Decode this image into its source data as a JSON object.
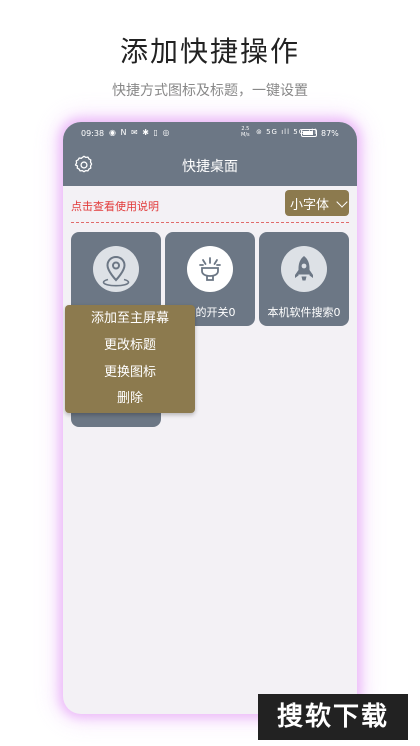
{
  "header": {
    "title": "添加快捷操作",
    "subtitle": "快捷方式图标及标题，一键设置"
  },
  "statusbar": {
    "time": "09:38",
    "left_icons": "◉ N ✉ ✱ ▯ ◎",
    "speed_value": "2.5",
    "speed_unit": "M/s",
    "signal": "⊚ 5G ıll 5G ıll",
    "battery_text": "87%",
    "battery_level": 0.87
  },
  "app": {
    "title": "快捷桌面",
    "settings_icon": "gear-icon",
    "help_link": "点击查看使用说明",
    "font_select": "小字体"
  },
  "cards": [
    {
      "label": "",
      "icon": "location-pin-icon"
    },
    {
      "label": "简的开关0",
      "icon": "lamp-icon"
    },
    {
      "label": "本机软件搜索0",
      "icon": "rocket-icon"
    }
  ],
  "context_menu": {
    "items": [
      "添加至主屏幕",
      "更改标题",
      "更换图标",
      "删除"
    ]
  },
  "watermark": "搜软下载",
  "colors": {
    "bar": "#6c7785",
    "accent": "#8c7a4e",
    "help_link": "#e23a3a",
    "glow": "#e096f5"
  }
}
